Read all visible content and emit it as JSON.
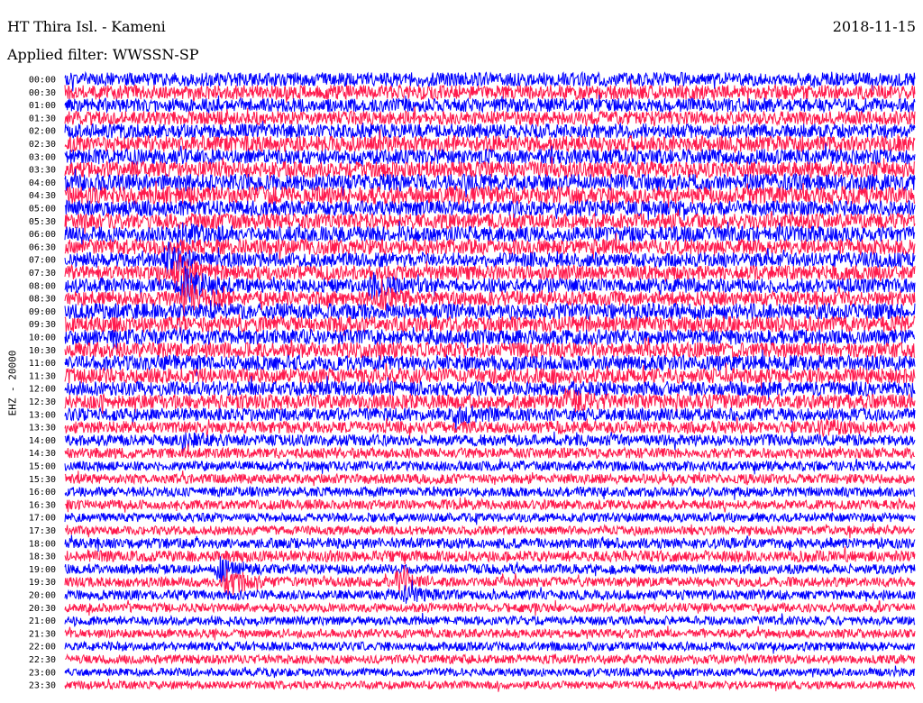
{
  "header": {
    "station": "HT Thira Isl. - Kameni",
    "date": "2018-11-15",
    "filter": "Applied filter: WWSSN-SP"
  },
  "chart_data": {
    "type": "line",
    "ylabel": "EHZ - 20000",
    "row_labels": [
      "00:00",
      "00:30",
      "01:00",
      "01:30",
      "02:00",
      "02:30",
      "03:00",
      "03:30",
      "04:00",
      "04:30",
      "05:00",
      "05:30",
      "06:00",
      "06:30",
      "07:00",
      "07:30",
      "08:00",
      "08:30",
      "09:00",
      "09:30",
      "10:00",
      "10:30",
      "11:00",
      "11:30",
      "12:00",
      "12:30",
      "13:00",
      "13:30",
      "14:00",
      "14:30",
      "15:00",
      "15:30",
      "16:00",
      "16:30",
      "17:00",
      "17:30",
      "18:00",
      "18:30",
      "19:00",
      "19:30",
      "20:00",
      "20:30",
      "21:00",
      "21:30",
      "22:00",
      "22:30",
      "23:00",
      "23:30"
    ],
    "trace_colors": [
      "#0000ff",
      "#ff1a4d"
    ],
    "noise_level": [
      0.85,
      0.9,
      0.85,
      0.85,
      0.9,
      1.0,
      0.95,
      1.0,
      1.05,
      1.1,
      0.95,
      0.95,
      0.95,
      0.95,
      0.9,
      0.9,
      0.9,
      0.9,
      1.0,
      1.0,
      0.95,
      0.95,
      0.95,
      0.95,
      0.9,
      0.9,
      0.8,
      0.75,
      0.7,
      0.65,
      0.6,
      0.6,
      0.6,
      0.6,
      0.55,
      0.55,
      0.65,
      0.7,
      0.6,
      0.6,
      0.6,
      0.55,
      0.55,
      0.55,
      0.55,
      0.55,
      0.5,
      0.5
    ],
    "events": [
      {
        "row": 12,
        "x_fraction": 0.13,
        "amplitude": 2.2
      },
      {
        "row": 14,
        "x_fraction": 0.12,
        "amplitude": 2.5
      },
      {
        "row": 15,
        "x_fraction": 0.13,
        "amplitude": 3.0
      },
      {
        "row": 16,
        "x_fraction": 0.14,
        "amplitude": 3.0
      },
      {
        "row": 17,
        "x_fraction": 0.14,
        "amplitude": 2.6
      },
      {
        "row": 16,
        "x_fraction": 0.36,
        "amplitude": 2.0
      },
      {
        "row": 17,
        "x_fraction": 0.37,
        "amplitude": 2.0
      },
      {
        "row": 25,
        "x_fraction": 0.59,
        "amplitude": 2.0
      },
      {
        "row": 26,
        "x_fraction": 0.46,
        "amplitude": 1.8
      },
      {
        "row": 27,
        "x_fraction": 0.89,
        "amplitude": 1.6
      },
      {
        "row": 28,
        "x_fraction": 0.14,
        "amplitude": 1.6
      },
      {
        "row": 38,
        "x_fraction": 0.18,
        "amplitude": 2.5
      },
      {
        "row": 39,
        "x_fraction": 0.19,
        "amplitude": 2.6
      },
      {
        "row": 39,
        "x_fraction": 0.39,
        "amplitude": 2.0
      },
      {
        "row": 40,
        "x_fraction": 0.4,
        "amplitude": 1.8
      }
    ]
  }
}
